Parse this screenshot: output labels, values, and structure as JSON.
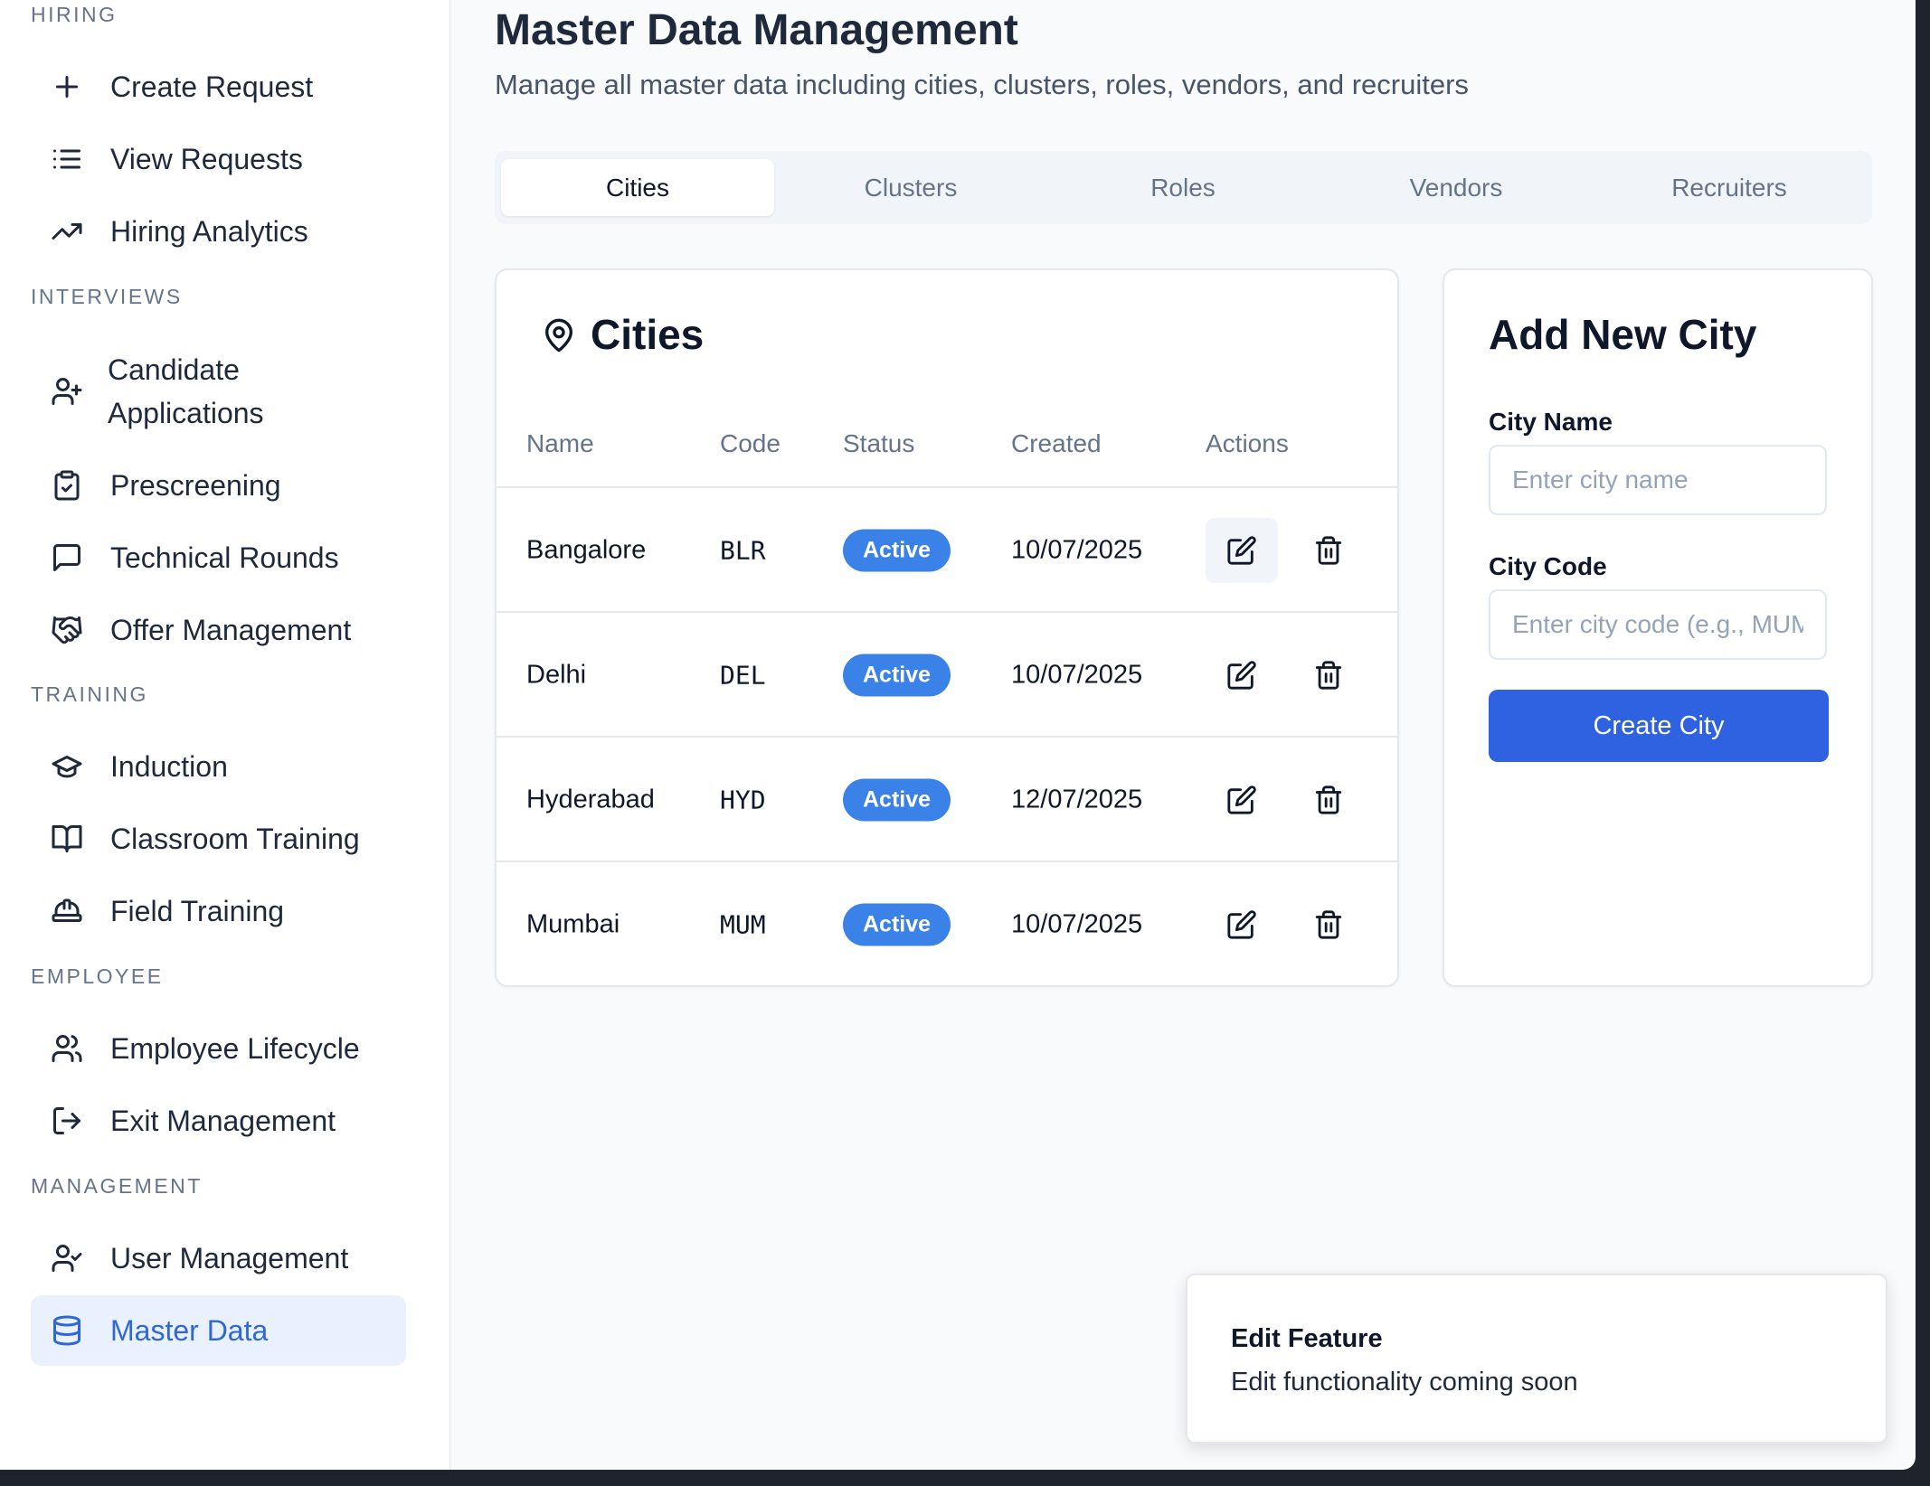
{
  "sidebar": {
    "sections": {
      "hiring": "HIRING",
      "interviews": "INTERVIEWS",
      "training": "TRAINING",
      "employee": "EMPLOYEE",
      "management": "MANAGEMENT"
    },
    "items": {
      "create_request": "Create Request",
      "view_requests": "View Requests",
      "hiring_analytics": "Hiring Analytics",
      "candidate_applications": "Candidate Applications",
      "prescreening": "Prescreening",
      "technical_rounds": "Technical Rounds",
      "offer_management": "Offer Management",
      "induction": "Induction",
      "classroom_training": "Classroom Training",
      "field_training": "Field Training",
      "employee_lifecycle": "Employee Lifecycle",
      "exit_management": "Exit Management",
      "user_management": "User Management",
      "master_data": "Master Data"
    },
    "active_item": "master_data",
    "accent_color": "#2f67d6"
  },
  "header": {
    "title": "Master Data Management",
    "subtitle": "Manage all master data including cities, clusters, roles, vendors, and recruiters"
  },
  "tabs": [
    {
      "label": "Cities",
      "active": true
    },
    {
      "label": "Clusters",
      "active": false
    },
    {
      "label": "Roles",
      "active": false
    },
    {
      "label": "Vendors",
      "active": false
    },
    {
      "label": "Recruiters",
      "active": false
    }
  ],
  "cities_table": {
    "title": "Cities",
    "columns": [
      "Name",
      "Code",
      "Status",
      "Created",
      "Actions"
    ],
    "rows": [
      {
        "name": "Bangalore",
        "code": "BLR",
        "status": "Active",
        "created": "10/07/2025"
      },
      {
        "name": "Delhi",
        "code": "DEL",
        "status": "Active",
        "created": "10/07/2025"
      },
      {
        "name": "Hyderabad",
        "code": "HYD",
        "status": "Active",
        "created": "12/07/2025"
      },
      {
        "name": "Mumbai",
        "code": "MUM",
        "status": "Active",
        "created": "10/07/2025"
      }
    ],
    "status_color": "#3b82e8"
  },
  "add_city": {
    "title": "Add New City",
    "name_label": "City Name",
    "name_placeholder": "Enter city name",
    "name_value": "",
    "code_label": "City Code",
    "code_placeholder": "Enter city code (e.g., MUM)",
    "code_value": "",
    "submit_label": "Create City",
    "button_color": "#2f62e0"
  },
  "toast": {
    "title": "Edit Feature",
    "description": "Edit functionality coming soon"
  }
}
